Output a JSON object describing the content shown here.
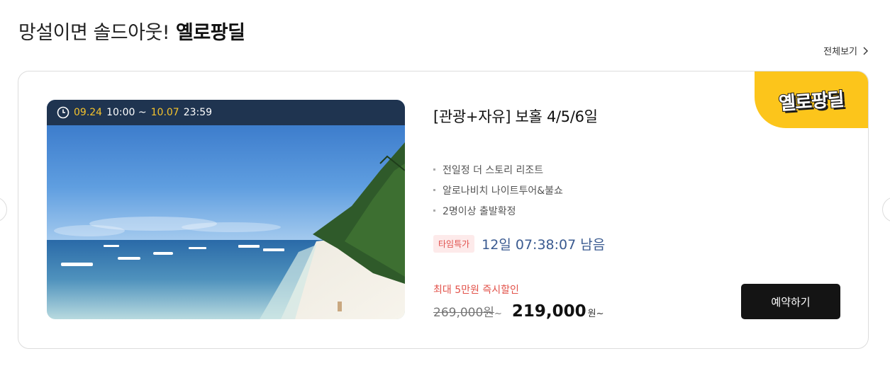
{
  "header": {
    "title_prefix": "망설이면 솔드아웃!",
    "title_brand": "옐로팡딜",
    "view_all": "전체보기"
  },
  "card": {
    "badge_text": "옐로팡딜",
    "sale_period": {
      "start_date": "09.24",
      "start_time": "10:00 ~",
      "end_date": "10.07",
      "end_time": "23:59"
    },
    "title": "[관광+자유] 보홀 4/5/6일",
    "features": [
      "전일정 더 스토리 리조트",
      "알로나비치 나이트투어&불쇼",
      "2명이상 출발확정"
    ],
    "timer_tag": "타임특가",
    "timer_text": "12일 07:38:07 남음",
    "discount_note": "최대 5만원 즉시할인",
    "original_price": "269,000원",
    "original_suffix": "~",
    "sale_price": "219,000",
    "sale_suffix": "원~",
    "book_button": "예약하기"
  },
  "colors": {
    "accent_yellow": "#fcc51b",
    "time_bar": "#1f3450",
    "timer_blue": "#3a5a90",
    "discount_red": "#e2524a",
    "button_dark": "#141414"
  }
}
